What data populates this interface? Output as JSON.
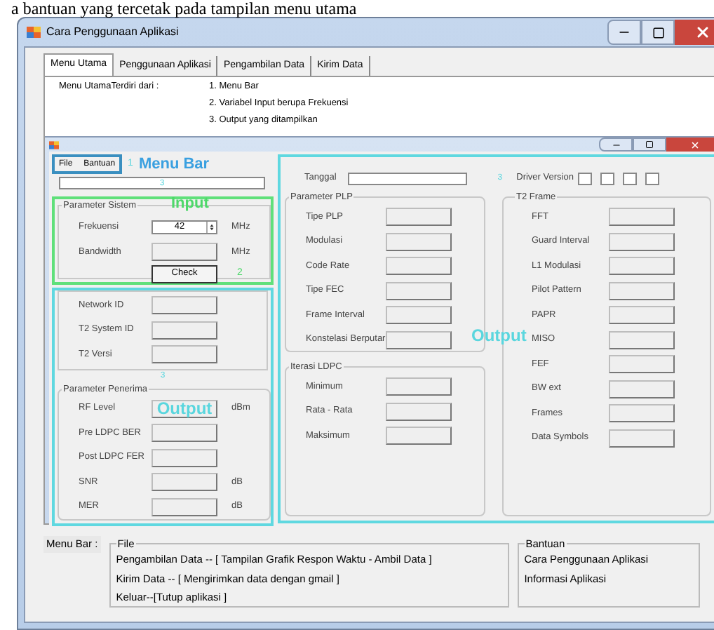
{
  "document_text": "a bantuan yang tercetak pada tampilan menu utama",
  "window": {
    "title": "Cara Penggunaan Aplikasi"
  },
  "tabs": [
    {
      "label": "Menu Utama",
      "selected": true
    },
    {
      "label": "Penggunaan Aplikasi",
      "selected": false
    },
    {
      "label": "Pengambilan Data",
      "selected": false
    },
    {
      "label": "Kirim Data",
      "selected": false
    }
  ],
  "description": {
    "label": "Menu UtamaTerdiri dari :",
    "items": [
      "1. Menu Bar",
      "2. Variabel Input berupa Frekuensi",
      "3. Output yang ditampilkan"
    ]
  },
  "screenshot": {
    "menu": [
      "File",
      "Bantuan"
    ],
    "menu_marker": "1",
    "menu_caption": "Menu Bar",
    "status_marker": "3",
    "input_caption": "Input",
    "input_marker": "2",
    "left_marker": "3",
    "left_caption": "Output",
    "right_marker": "3",
    "right_caption": "Output",
    "sistem": {
      "title": "Parameter Sistem",
      "rows": [
        {
          "label": "Frekuensi",
          "kind": "spin",
          "value": "42",
          "unit": "MHz"
        },
        {
          "label": "Bandwidth",
          "kind": "box",
          "unit": "MHz"
        }
      ],
      "button": "Check"
    },
    "ids": [
      {
        "label": "Network ID"
      },
      {
        "label": "T2 System ID"
      },
      {
        "label": "T2 Versi"
      }
    ],
    "penerima": {
      "title": "Parameter Penerima",
      "rows": [
        {
          "label": "RF Level",
          "unit": "dBm"
        },
        {
          "label": "Pre LDPC BER"
        },
        {
          "label": "Post LDPC FER"
        },
        {
          "label": "SNR",
          "unit": "dB"
        },
        {
          "label": "MER",
          "unit": "dB"
        }
      ]
    },
    "tanggal_label": "Tanggal",
    "driver_label": "Driver Version",
    "plp": {
      "title": "Parameter PLP",
      "rows": [
        {
          "label": "Tipe PLP"
        },
        {
          "label": "Modulasi"
        },
        {
          "label": "Code Rate"
        },
        {
          "label": "Tipe FEC"
        },
        {
          "label": "Frame Interval"
        },
        {
          "label": "Konstelasi Berputar"
        }
      ]
    },
    "ldpc": {
      "title": "Iterasi LDPC",
      "rows": [
        {
          "label": "Minimum"
        },
        {
          "label": "Rata - Rata"
        },
        {
          "label": "Maksimum"
        }
      ]
    },
    "t2": {
      "title": "T2 Frame",
      "rows": [
        {
          "label": "FFT"
        },
        {
          "label": "Guard Interval"
        },
        {
          "label": "L1 Modulasi"
        },
        {
          "label": "Pilot Pattern"
        },
        {
          "label": "PAPR"
        },
        {
          "label": "MISO"
        },
        {
          "label": "FEF"
        },
        {
          "label": "BW ext"
        },
        {
          "label": "Frames"
        },
        {
          "label": "Data Symbols"
        }
      ]
    }
  },
  "help": {
    "label": "Menu Bar :",
    "groups": [
      {
        "title": "File",
        "items": [
          "Pengambilan Data -- [ Tampilan Grafik Respon Waktu - Ambil Data ]",
          "Kirim Data -- [ Mengirimkan data dengan gmail ]",
          "Keluar--[Tutup aplikasi ]"
        ]
      },
      {
        "title": "Bantuan",
        "items": [
          "Cara Penggunaan Aplikasi",
          "Informasi Aplikasi"
        ]
      }
    ]
  }
}
